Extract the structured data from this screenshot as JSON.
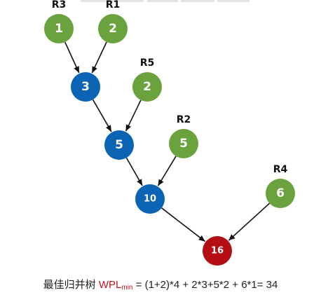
{
  "colors": {
    "leaf": "#6aa23e",
    "internal": "#0b63b4",
    "root": "#b40d13",
    "edge": "#111111",
    "wpl_text": "#c8141c"
  },
  "nodes": {
    "r3": {
      "value": "1",
      "run": "R3",
      "kind": "leaf"
    },
    "r1": {
      "value": "2",
      "run": "R1",
      "kind": "leaf"
    },
    "m3": {
      "value": "3",
      "kind": "internal"
    },
    "r5": {
      "value": "2",
      "run": "R5",
      "kind": "leaf"
    },
    "m5": {
      "value": "5",
      "kind": "internal"
    },
    "r2": {
      "value": "5",
      "run": "R2",
      "kind": "leaf"
    },
    "m10": {
      "value": "10",
      "kind": "internal"
    },
    "r4": {
      "value": "6",
      "run": "R4",
      "kind": "leaf"
    },
    "root": {
      "value": "16",
      "kind": "root"
    }
  },
  "edges": [
    [
      "r3",
      "m3"
    ],
    [
      "r1",
      "m3"
    ],
    [
      "m3",
      "m5"
    ],
    [
      "r5",
      "m5"
    ],
    [
      "m5",
      "m10"
    ],
    [
      "r2",
      "m10"
    ],
    [
      "m10",
      "root"
    ],
    [
      "r4",
      "root"
    ]
  ],
  "caption": {
    "prefix": "最佳归并树",
    "wpl": "WPL",
    "sub": "min",
    "expr": "= (1+2)*4 + 2*3+5*2 + 6*1= 34"
  }
}
